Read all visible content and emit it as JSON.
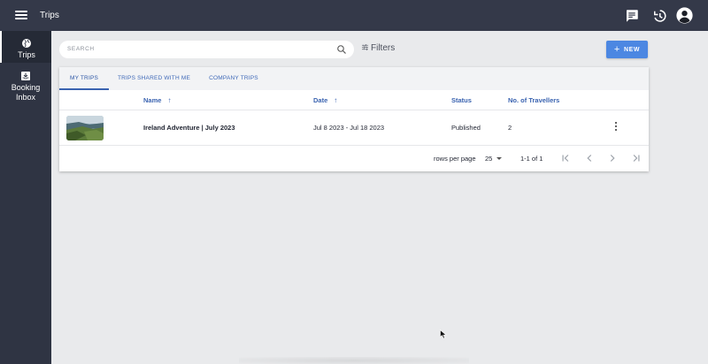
{
  "header": {
    "title": "Trips"
  },
  "sidebar": {
    "items": [
      {
        "label": "Trips"
      },
      {
        "label_line1": "Booking",
        "label_line2": "Inbox"
      }
    ]
  },
  "search": {
    "placeholder": "SEARCH"
  },
  "filters": {
    "label": "Filters"
  },
  "new_button": {
    "label": "NEW"
  },
  "tabs": [
    {
      "label": "MY TRIPS"
    },
    {
      "label": "TRIPS SHARED WITH ME"
    },
    {
      "label": "COMPANY TRIPS"
    }
  ],
  "table": {
    "columns": [
      {
        "label": "Name"
      },
      {
        "label": "Date"
      },
      {
        "label": "Status"
      },
      {
        "label": "No. of Travellers"
      }
    ],
    "sort_arrow": "↑",
    "rows": [
      {
        "name": "Ireland Adventure | July 2023",
        "date": "Jul 8 2023 - Jul 18 2023",
        "status": "Published",
        "travellers": "2"
      }
    ]
  },
  "pagination": {
    "rows_per_page_label": "rows per page",
    "rows_per_page_value": "25",
    "range": "1-1 of 1"
  },
  "colors": {
    "topbar": "#343949",
    "sidebar": "#2f3443",
    "accent": "#4c87e2",
    "link": "#3a63b0"
  }
}
